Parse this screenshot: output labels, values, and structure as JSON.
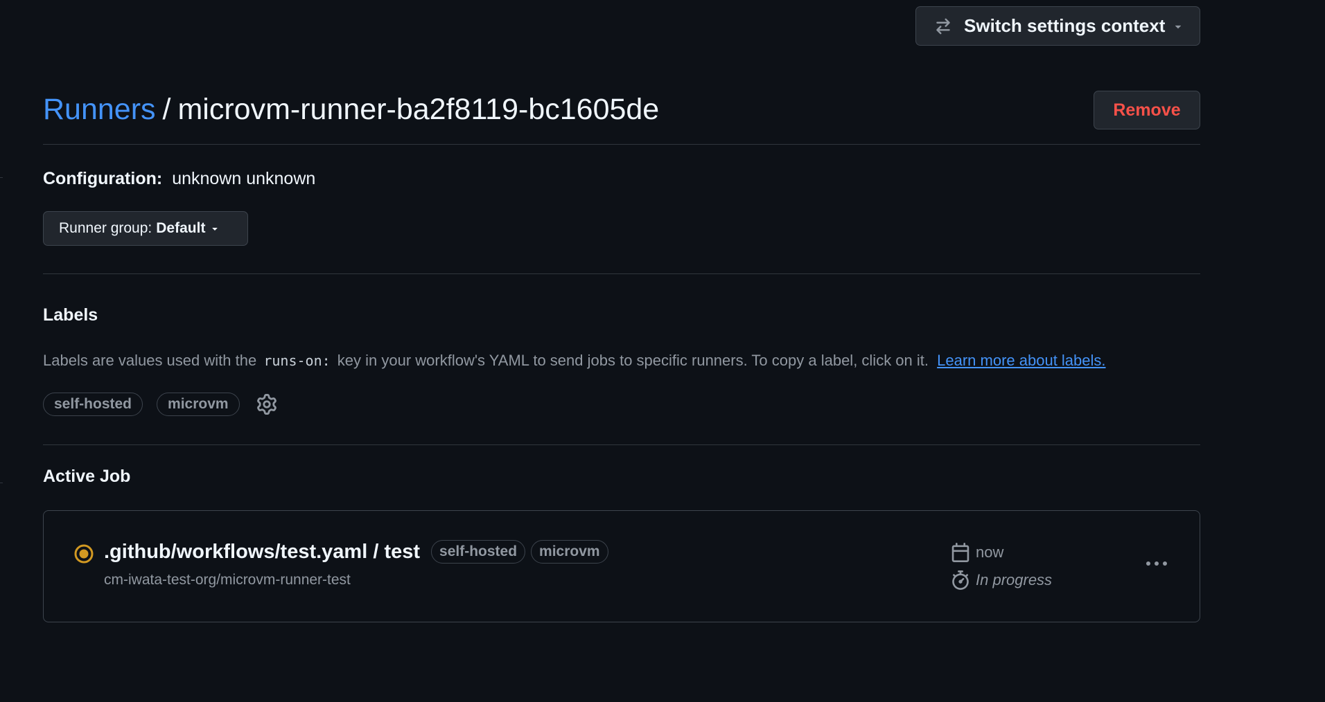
{
  "header": {
    "context_button_label": "Switch settings context",
    "breadcrumb_parent": "Runners",
    "breadcrumb_separator": "/",
    "breadcrumb_current": "microvm-runner-ba2f8119-bc1605de",
    "remove_label": "Remove"
  },
  "configuration": {
    "key": "Configuration:",
    "value": "unknown unknown"
  },
  "runner_group": {
    "prefix": "Runner group:",
    "value": "Default"
  },
  "labels_section": {
    "title": "Labels",
    "description_before": "Labels are values used with the",
    "code": "runs-on:",
    "description_after": "key in your workflow's YAML to send jobs to specific runners. To copy a label, click on it.",
    "learn_more": "Learn more about labels.",
    "labels": [
      "self-hosted",
      "microvm"
    ]
  },
  "active_job": {
    "title": "Active Job",
    "job_title": ".github/workflows/test.yaml / test",
    "labels": [
      "self-hosted",
      "microvm"
    ],
    "repo": "cm-iwata-test-org/microvm-runner-test",
    "time": "now",
    "status": "In progress",
    "status_color": "#d29922"
  },
  "colors": {
    "background": "#0d1117",
    "link": "#4493f8",
    "danger": "#f85149",
    "muted": "#9198a1",
    "border": "#3d444d"
  }
}
